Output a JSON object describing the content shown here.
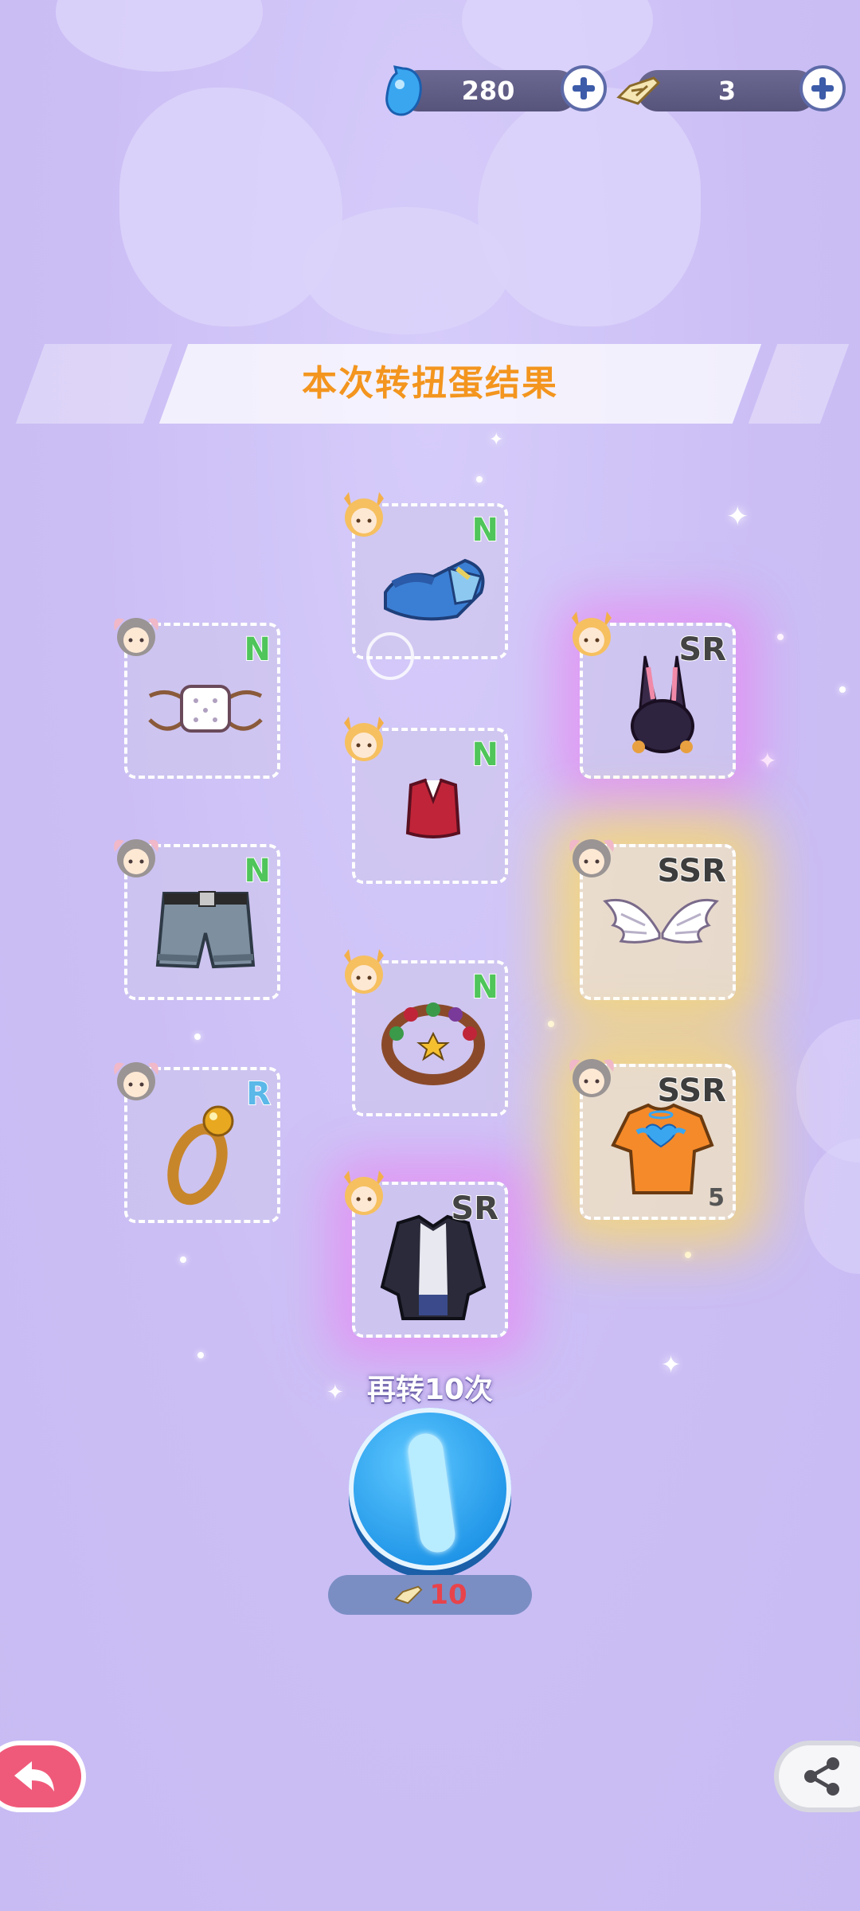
{
  "currency": {
    "gems": {
      "icon": "blue-gem-icon",
      "value": "280"
    },
    "tickets": {
      "icon": "fishbone-ticket-icon",
      "value": "3"
    }
  },
  "banner": {
    "title": "本次转扭蛋结果"
  },
  "items": [
    {
      "name": "blue-wedge-sandals",
      "rarity": "N",
      "avatar": "blonde-cat-avatar"
    },
    {
      "name": "white-face-mask",
      "rarity": "N",
      "avatar": "gray-bunny-avatar"
    },
    {
      "name": "black-bunny-ear-hat",
      "rarity": "SR",
      "avatar": "blonde-cat-avatar"
    },
    {
      "name": "red-crop-top",
      "rarity": "N",
      "avatar": "blonde-cat-avatar"
    },
    {
      "name": "denim-shorts",
      "rarity": "N",
      "avatar": "gray-bunny-avatar"
    },
    {
      "name": "angel-wings",
      "rarity": "SSR",
      "avatar": "gray-bunny-avatar"
    },
    {
      "name": "bead-bracelet",
      "rarity": "N",
      "avatar": "blonde-cat-avatar"
    },
    {
      "name": "gold-ring",
      "rarity": "R",
      "avatar": "gray-bunny-avatar"
    },
    {
      "name": "orange-angel-tshirt",
      "rarity": "SSR",
      "avatar": "gray-bunny-avatar",
      "count": "5"
    },
    {
      "name": "black-jacket-outfit",
      "rarity": "SR",
      "avatar": "blonde-cat-avatar"
    }
  ],
  "spin_again": {
    "label": "再转10次",
    "cost": "10",
    "cost_icon": "fishbone-ticket-icon"
  },
  "buttons": {
    "back_icon": "back-arrow-icon",
    "share_icon": "share-icon"
  },
  "colors": {
    "background": "#cfc3f7",
    "banner_text": "#f3951e",
    "rarity_N": "#4fc55a",
    "rarity_R": "#5bb8e8",
    "spin_button": "#2196e8",
    "cost_text": "#e8434b",
    "back_button": "#f05a7a"
  }
}
